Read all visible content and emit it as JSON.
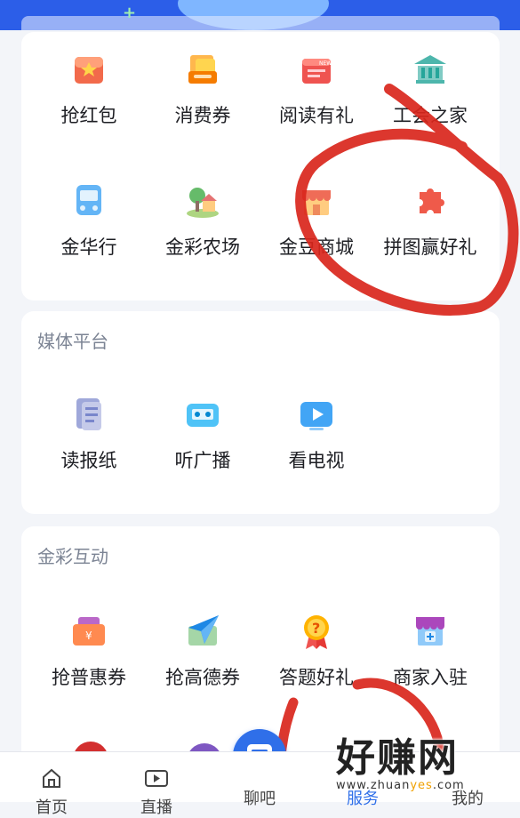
{
  "services_top": {
    "row1": [
      {
        "label": "抢红包",
        "icon": "red-envelope-icon"
      },
      {
        "label": "消费券",
        "icon": "coupon-icon"
      },
      {
        "label": "阅读有礼",
        "icon": "news-gift-icon"
      },
      {
        "label": "工会之家",
        "icon": "union-building-icon"
      }
    ],
    "row2": [
      {
        "label": "金华行",
        "icon": "bus-icon"
      },
      {
        "label": "金彩农场",
        "icon": "farm-house-icon"
      },
      {
        "label": "金豆商城",
        "icon": "shop-icon"
      },
      {
        "label": "拼图赢好礼",
        "icon": "puzzle-icon"
      }
    ]
  },
  "media": {
    "title": "媒体平台",
    "items": [
      {
        "label": "读报纸",
        "icon": "newspaper-icon"
      },
      {
        "label": "听广播",
        "icon": "radio-icon"
      },
      {
        "label": "看电视",
        "icon": "tv-icon"
      }
    ]
  },
  "interact": {
    "title": "金彩互动",
    "items": [
      {
        "label": "抢普惠券",
        "icon": "discount-voucher-icon"
      },
      {
        "label": "抢高德券",
        "icon": "paper-plane-map-icon"
      },
      {
        "label": "答题好礼",
        "icon": "question-medal-icon"
      },
      {
        "label": "商家入驻",
        "icon": "store-add-icon"
      }
    ]
  },
  "nav": {
    "items": [
      {
        "label": "首页",
        "icon": "home-icon"
      },
      {
        "label": "直播",
        "icon": "video-icon"
      },
      {
        "label": "聊吧",
        "icon": "chat-icon"
      },
      {
        "label": "服务",
        "icon": "service-icon"
      },
      {
        "label": "我的",
        "icon": "profile-icon"
      }
    ]
  },
  "watermark": {
    "title": "好赚网",
    "domain_prefix": "www.zhuan",
    "domain_accent": "yes",
    "domain_suffix": ".com"
  },
  "colors": {
    "primary": "#2f6fe9",
    "annotation": "#d9261c",
    "card_bg": "#ffffff",
    "page_bg": "#f3f5f9"
  }
}
